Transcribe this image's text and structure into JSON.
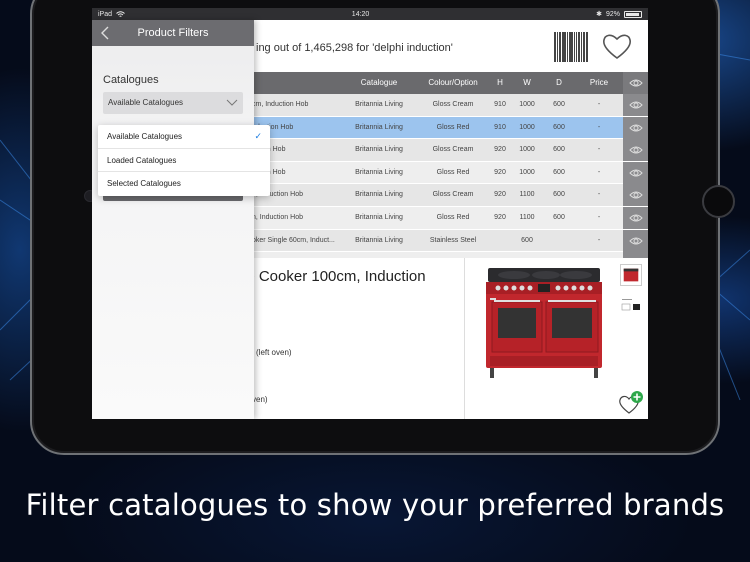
{
  "statusbar": {
    "device": "iPad",
    "time": "14:20",
    "battery": "92%"
  },
  "header": {
    "results_text": "ing out of 1,465,298 for 'delphi induction'",
    "barcode_icon": "barcode-icon",
    "favourites_icon": "heart-icon"
  },
  "table": {
    "columns": [
      "Catalogue",
      "Colour/Option",
      "H",
      "W",
      "D",
      "Price"
    ],
    "rows": [
      {
        "name": "cm, Induction Hob",
        "catalogue": "Britannia Living",
        "colour": "Gloss Cream",
        "h": "910",
        "w": "1000",
        "d": "600",
        "price": "-"
      },
      {
        "name": "nduction Hob",
        "catalogue": "Britannia Living",
        "colour": "Gloss Red",
        "h": "910",
        "w": "1000",
        "d": "600",
        "price": "-"
      },
      {
        "name": "uction Hob",
        "catalogue": "Britannia Living",
        "colour": "Gloss Cream",
        "h": "920",
        "w": "1000",
        "d": "600",
        "price": "-"
      },
      {
        "name": "uction Hob",
        "catalogue": "Britannia Living",
        "colour": "Gloss Red",
        "h": "920",
        "w": "1000",
        "d": "600",
        "price": "-"
      },
      {
        "name": "n, Induction Hob",
        "catalogue": "Britannia Living",
        "colour": "Gloss Cream",
        "h": "920",
        "w": "1100",
        "d": "600",
        "price": "-"
      },
      {
        "name": "n, Induction Hob",
        "catalogue": "Britannia Living",
        "colour": "Gloss Red",
        "h": "920",
        "w": "1100",
        "d": "600",
        "price": "-"
      },
      {
        "name": "oker Single 60cm, Induct...",
        "catalogue": "Britannia Living",
        "colour": "Stainless Steel",
        "h": "",
        "w": "600",
        "d": "",
        "price": "-"
      },
      {
        "name": "cm, Induction Hob",
        "catalogue": "Britannia Living",
        "colour": "Gloss Cream",
        "h": "910",
        "w": "900",
        "d": "600",
        "price": "-"
      }
    ]
  },
  "detail": {
    "title": "ge Cooker 100cm, Induction",
    "line1": "(left oven)",
    "line2": "ven)"
  },
  "panel": {
    "title": "Product Filters",
    "catalogues_label": "Catalogues",
    "selected_value": "Available Catalogues",
    "reset_label": "Reset Filters",
    "options": [
      {
        "label": "Available Catalogues",
        "check": "✓"
      },
      {
        "label": "Loaded Catalogues",
        "check": ""
      },
      {
        "label": "Selected Catalogues",
        "check": ""
      }
    ]
  },
  "caption": "Filter catalogues to show your preferred brands",
  "colors": {
    "accent": "#1a7be0",
    "selected_row": "#9cc4ee",
    "header_grey": "#6a6a6d",
    "cooker_red": "#c1272d"
  }
}
